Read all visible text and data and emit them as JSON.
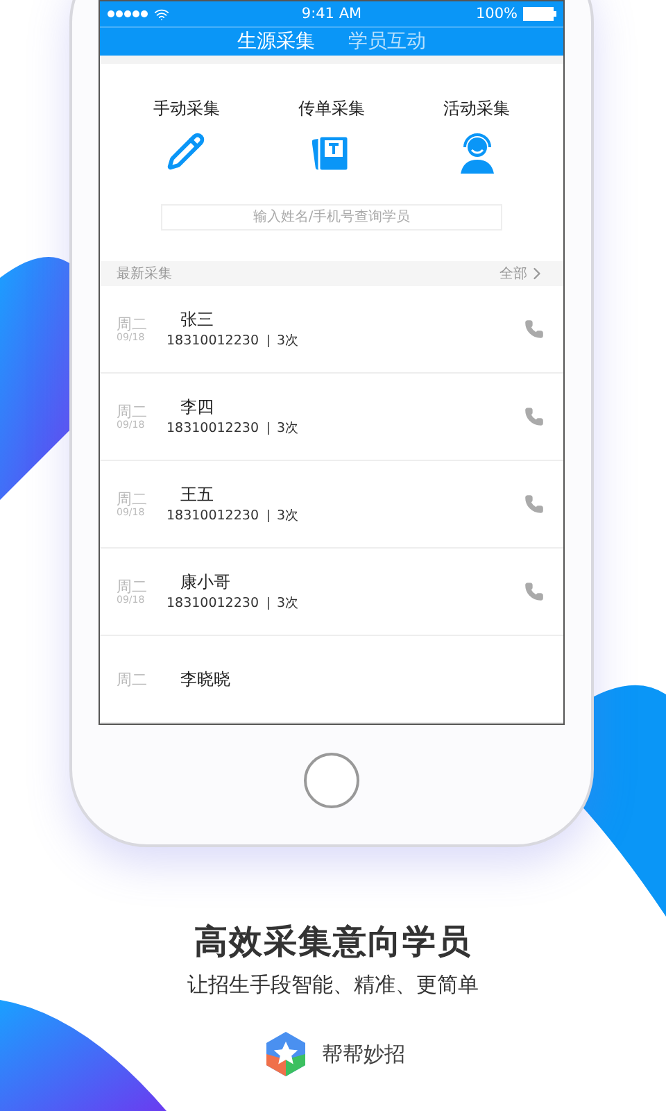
{
  "status_bar": {
    "time": "9:41 AM",
    "battery": "100%"
  },
  "tabs": [
    {
      "label": "生源采集",
      "selected": true
    },
    {
      "label": "学员互动",
      "selected": false
    }
  ],
  "actions": [
    {
      "label": "手动采集",
      "kind": "pencil"
    },
    {
      "label": "传单采集",
      "kind": "flyer"
    },
    {
      "label": "活动采集",
      "kind": "agent"
    }
  ],
  "search": {
    "placeholder": "输入姓名/手机号查询学员"
  },
  "list_header": {
    "title": "最新采集",
    "link": "全部"
  },
  "rows": [
    {
      "day": "周二",
      "date": "09/18",
      "name": "张三",
      "phone": "18310012230",
      "count": "3次"
    },
    {
      "day": "周二",
      "date": "09/18",
      "name": "李四",
      "phone": "18310012230",
      "count": "3次"
    },
    {
      "day": "周二",
      "date": "09/18",
      "name": "王五",
      "phone": "18310012230",
      "count": "3次"
    },
    {
      "day": "周二",
      "date": "09/18",
      "name": "康小哥",
      "phone": "18310012230",
      "count": "3次"
    },
    {
      "day": "周二",
      "name": "李晓晓"
    }
  ],
  "headline": "高效采集意向学员",
  "subtitle": "让招生手段智能、精准、更简单",
  "brand": "帮帮妙招"
}
